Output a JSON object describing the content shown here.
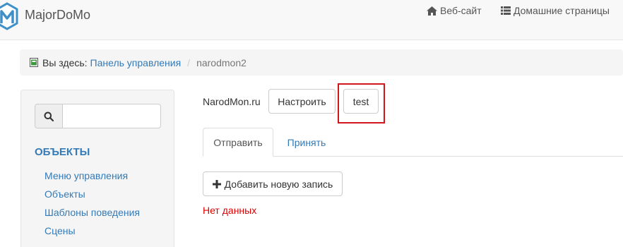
{
  "colors": {
    "accent": "#337ab7",
    "highlight": "#d0171b",
    "error": "#dd0000"
  },
  "navbar": {
    "brand": "MajorDoMo",
    "links": [
      {
        "label": "Веб-сайт",
        "icon": "home-icon"
      },
      {
        "label": "Домашние страницы",
        "icon": "list-icon"
      }
    ]
  },
  "breadcrumb": {
    "prefix": "Вы здесь:",
    "link": "Панель управления",
    "separator": "/",
    "current": "narodmon2"
  },
  "sidebar": {
    "search": {
      "placeholder": "",
      "value": "",
      "icon": "search-icon"
    },
    "heading": "ОБЪЕКТЫ",
    "items": [
      {
        "label": "Меню управления"
      },
      {
        "label": "Объекты"
      },
      {
        "label": "Шаблоны поведения"
      },
      {
        "label": "Сцены"
      }
    ]
  },
  "main": {
    "title": "NarodMon.ru",
    "configure_label": "Настроить",
    "test_label": "test",
    "tabs": [
      {
        "label": "Отправить",
        "active": true
      },
      {
        "label": "Принять",
        "active": false
      }
    ],
    "add_label": "Добавить новую запись",
    "empty_text": "Нет данных"
  }
}
